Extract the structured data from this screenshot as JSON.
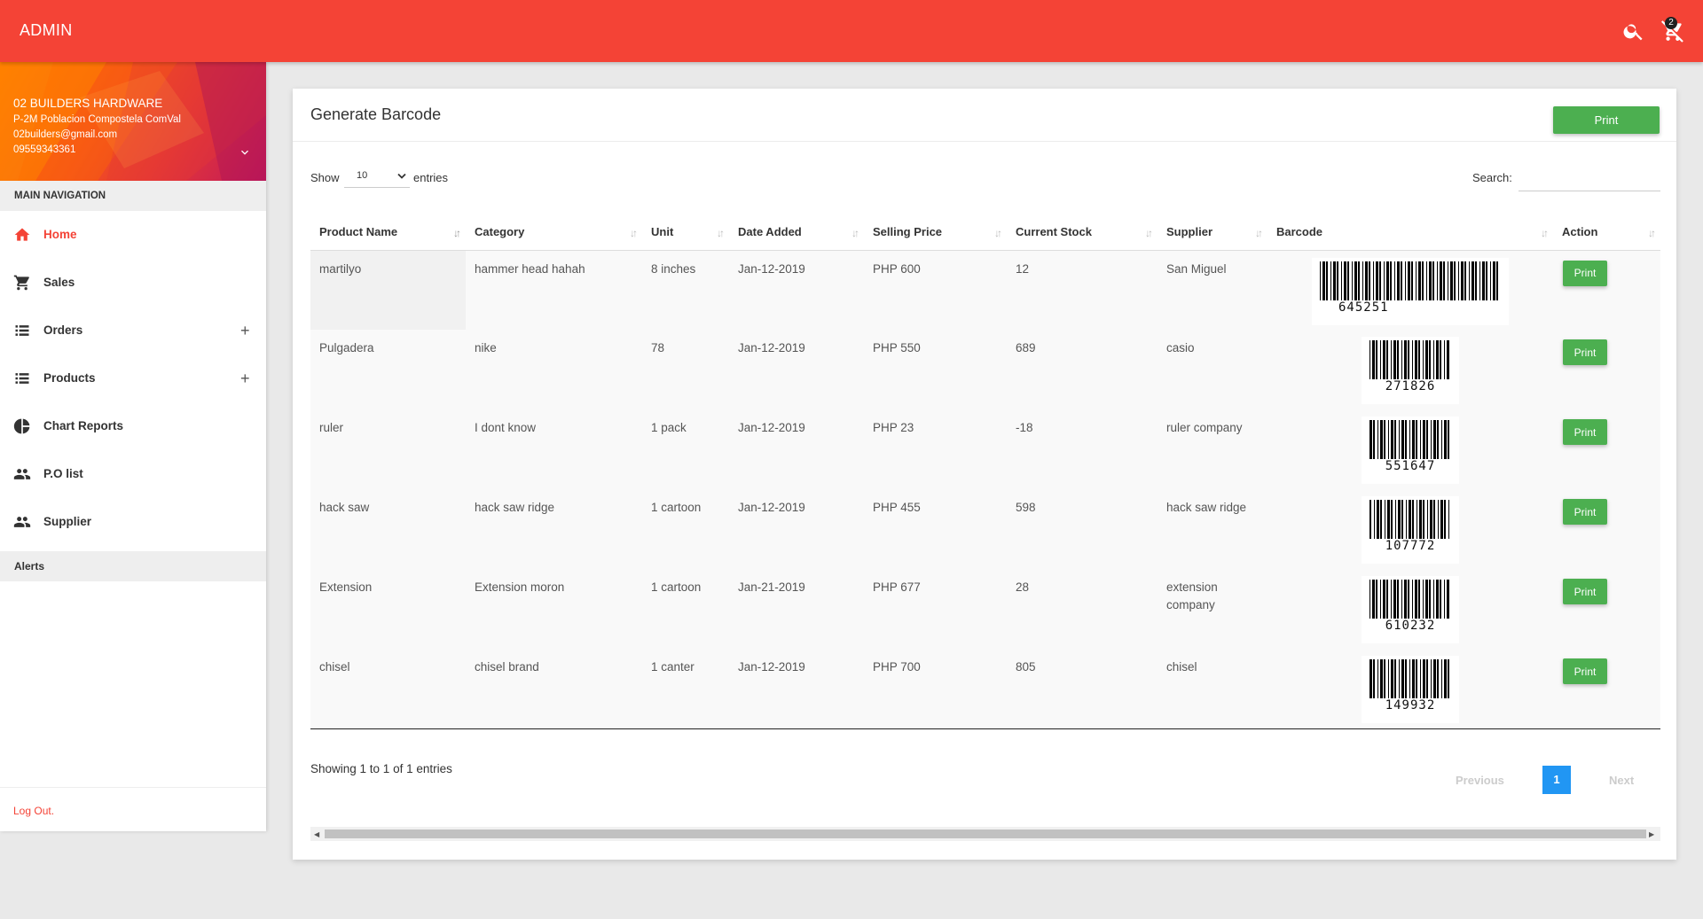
{
  "app": {
    "title": "ADMIN",
    "cart_count": "2",
    "search_icon": "search-icon",
    "cart_icon": "cart-off-icon"
  },
  "user": {
    "name": "02 BUILDERS HARDWARE",
    "address": "P-2M Poblacion  Compostela ComVal",
    "email": "02builders@gmail.com",
    "phone": "09559343361"
  },
  "sidebar": {
    "header": "MAIN NAVIGATION",
    "items": [
      {
        "label": "Home",
        "icon": "home-icon",
        "active": true,
        "expandable": false
      },
      {
        "label": "Sales",
        "icon": "cart-icon",
        "active": false,
        "expandable": false
      },
      {
        "label": "Orders",
        "icon": "list-icon",
        "active": false,
        "expandable": true
      },
      {
        "label": "Products",
        "icon": "list-icon",
        "active": false,
        "expandable": true
      },
      {
        "label": "Chart Reports",
        "icon": "pie-chart-icon",
        "active": false,
        "expandable": false
      },
      {
        "label": "P.O list",
        "icon": "people-icon",
        "active": false,
        "expandable": false
      },
      {
        "label": "Supplier",
        "icon": "people-icon",
        "active": false,
        "expandable": false
      }
    ],
    "alerts": "Alerts",
    "logout": "Log Out."
  },
  "card": {
    "title": "Generate Barcode",
    "print_label": "Print",
    "show_label": "Show",
    "entries_value": "10",
    "entries_label": "entries",
    "search_label": "Search:",
    "search_placeholder": ""
  },
  "table": {
    "columns": [
      "Product Name",
      "Category",
      "Unit",
      "Date Added",
      "Selling Price",
      "Current Stock",
      "Supplier",
      "Barcode",
      "Action"
    ],
    "rows": [
      {
        "name": "martilyo",
        "category": "hammer head hahah",
        "unit": "8 inches",
        "date": "Jan-12-2019",
        "price": "PHP 600",
        "stock": "12",
        "supplier": "San Miguel",
        "barcode": "645251",
        "action": "Print"
      },
      {
        "name": "Pulgadera",
        "category": "nike",
        "unit": "78",
        "date": "Jan-12-2019",
        "price": "PHP 550",
        "stock": "689",
        "supplier": "casio",
        "barcode": "271826",
        "action": "Print"
      },
      {
        "name": "ruler",
        "category": "I dont know",
        "unit": "1 pack",
        "date": "Jan-12-2019",
        "price": "PHP 23",
        "stock": "-18",
        "supplier": "ruler company",
        "barcode": "551647",
        "action": "Print"
      },
      {
        "name": "hack saw",
        "category": "hack saw ridge",
        "unit": "1 cartoon",
        "date": "Jan-12-2019",
        "price": "PHP 455",
        "stock": "598",
        "supplier": "hack saw ridge",
        "barcode": "107772",
        "action": "Print"
      },
      {
        "name": "Extension",
        "category": "Extension moron",
        "unit": "1 cartoon",
        "date": "Jan-21-2019",
        "price": "PHP 677",
        "stock": "28",
        "supplier": "extension company",
        "barcode": "610232",
        "action": "Print"
      },
      {
        "name": "chisel",
        "category": "chisel brand",
        "unit": "1 canter",
        "date": "Jan-12-2019",
        "price": "PHP 700",
        "stock": "805",
        "supplier": "chisel",
        "barcode": "149932",
        "action": "Print"
      }
    ]
  },
  "footer": {
    "info": "Showing 1 to 1 of 1 entries",
    "previous": "Previous",
    "page": "1",
    "next": "Next"
  },
  "colors": {
    "primary": "#f44336",
    "green": "#4caf50",
    "blue": "#2196f3"
  }
}
